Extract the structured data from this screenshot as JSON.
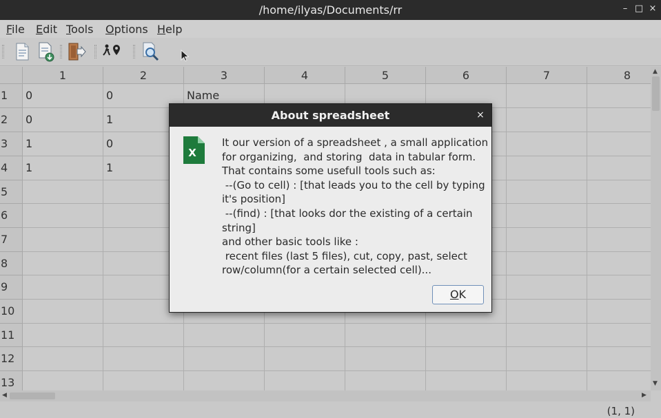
{
  "window": {
    "title": "/home/ilyas/Documents/rr",
    "minimize_glyph": "–",
    "maximize_glyph": "□",
    "close_glyph": "×"
  },
  "menu": {
    "items": [
      {
        "accel": "F",
        "rest": "ile"
      },
      {
        "accel": "E",
        "rest": "dit"
      },
      {
        "accel": "T",
        "rest": "ools"
      },
      {
        "accel": "O",
        "rest": "ptions"
      },
      {
        "accel": "H",
        "rest": "elp"
      }
    ]
  },
  "toolbar": {
    "icons": [
      "new-document-icon",
      "save-document-icon",
      "exit-door-icon",
      "go-to-cell-icon",
      "find-icon"
    ]
  },
  "sheet": {
    "columns": [
      "1",
      "2",
      "3",
      "4",
      "5",
      "6",
      "7",
      "8"
    ],
    "rows": [
      "1",
      "2",
      "3",
      "4",
      "5",
      "6",
      "7",
      "8",
      "9",
      "10",
      "11",
      "12",
      "13"
    ],
    "cells": [
      [
        "0",
        "0",
        "Name"
      ],
      [
        "0",
        "1",
        ""
      ],
      [
        "1",
        "0",
        ""
      ],
      [
        "1",
        "1",
        ""
      ]
    ]
  },
  "status": {
    "position": "(1, 1)"
  },
  "dialog": {
    "title": "About spreadsheet",
    "close_glyph": "×",
    "icon_letter": "X",
    "icon_color": "#1e7b3c",
    "lines": [
      "It our version of a spreadsheet , a small application",
      "for organizing,  and storing  data in tabular form.",
      "That contains some usefull tools such as:",
      " --(Go to cell) : [that leads you to the cell by typing",
      "it's position]",
      " --(find) : [that looks dor the existing of a certain",
      "string]",
      "and other basic tools like :",
      " recent files (last 5 files), cut, copy, past, select",
      "row/column(for a certain selected cell)..."
    ],
    "ok": {
      "accel": "O",
      "rest": "K"
    }
  }
}
